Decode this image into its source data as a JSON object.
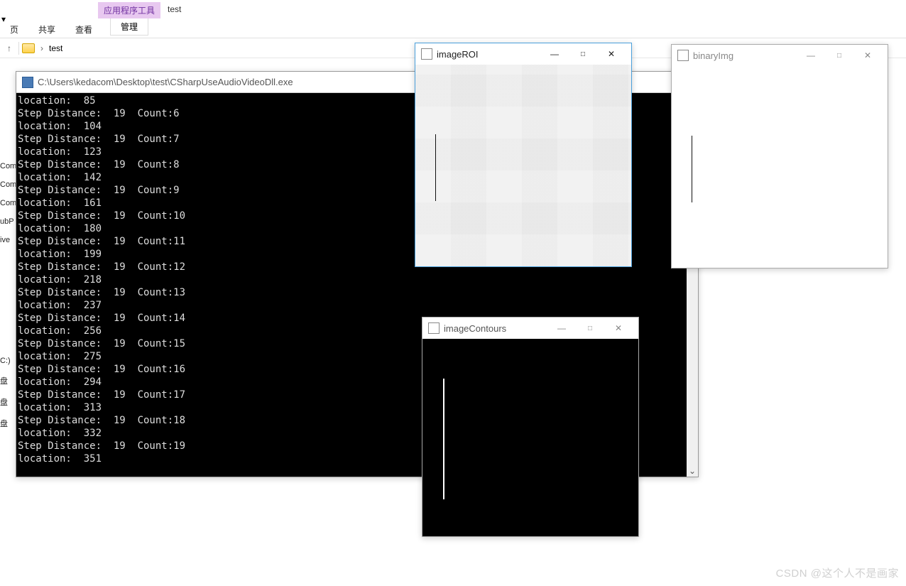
{
  "ribbon": {
    "qa": "▾",
    "context_tool": "应用程序工具",
    "context_name": "test",
    "context_lower": "管理",
    "tabs": [
      "页",
      "共享",
      "查看"
    ]
  },
  "address": {
    "up_icon": "↑",
    "chevron": "›",
    "folder": "test"
  },
  "left_sliver": [
    "",
    "Com",
    "Com",
    "Com",
    "ubP",
    "ive",
    "",
    "C:)",
    "盘",
    "盘",
    "盘"
  ],
  "console": {
    "title": "C:\\Users\\kedacom\\Desktop\\test\\CSharpUseAudioVideoDll.exe",
    "maximize_glyph": "□",
    "scroll_down": "⌄",
    "lines": [
      "location:  85",
      "Step Distance:  19  Count:6",
      "location:  104",
      "Step Distance:  19  Count:7",
      "location:  123",
      "Step Distance:  19  Count:8",
      "location:  142",
      "Step Distance:  19  Count:9",
      "location:  161",
      "Step Distance:  19  Count:10",
      "location:  180",
      "Step Distance:  19  Count:11",
      "location:  199",
      "Step Distance:  19  Count:12",
      "location:  218",
      "Step Distance:  19  Count:13",
      "location:  237",
      "Step Distance:  19  Count:14",
      "location:  256",
      "Step Distance:  19  Count:15",
      "location:  275",
      "Step Distance:  19  Count:16",
      "location:  294",
      "Step Distance:  19  Count:17",
      "location:  313",
      "Step Distance:  19  Count:18",
      "location:  332",
      "Step Distance:  19  Count:19",
      "location:  351"
    ]
  },
  "win_roi": {
    "title": "imageROI",
    "min": "—",
    "max": "□",
    "close": "✕"
  },
  "win_binary": {
    "title": "binaryImg",
    "min": "—",
    "max": "□",
    "close": "✕"
  },
  "win_contours": {
    "title": "imageContours",
    "min": "—",
    "max": "□",
    "close": "✕"
  },
  "watermark": "CSDN @这个人不是画家"
}
